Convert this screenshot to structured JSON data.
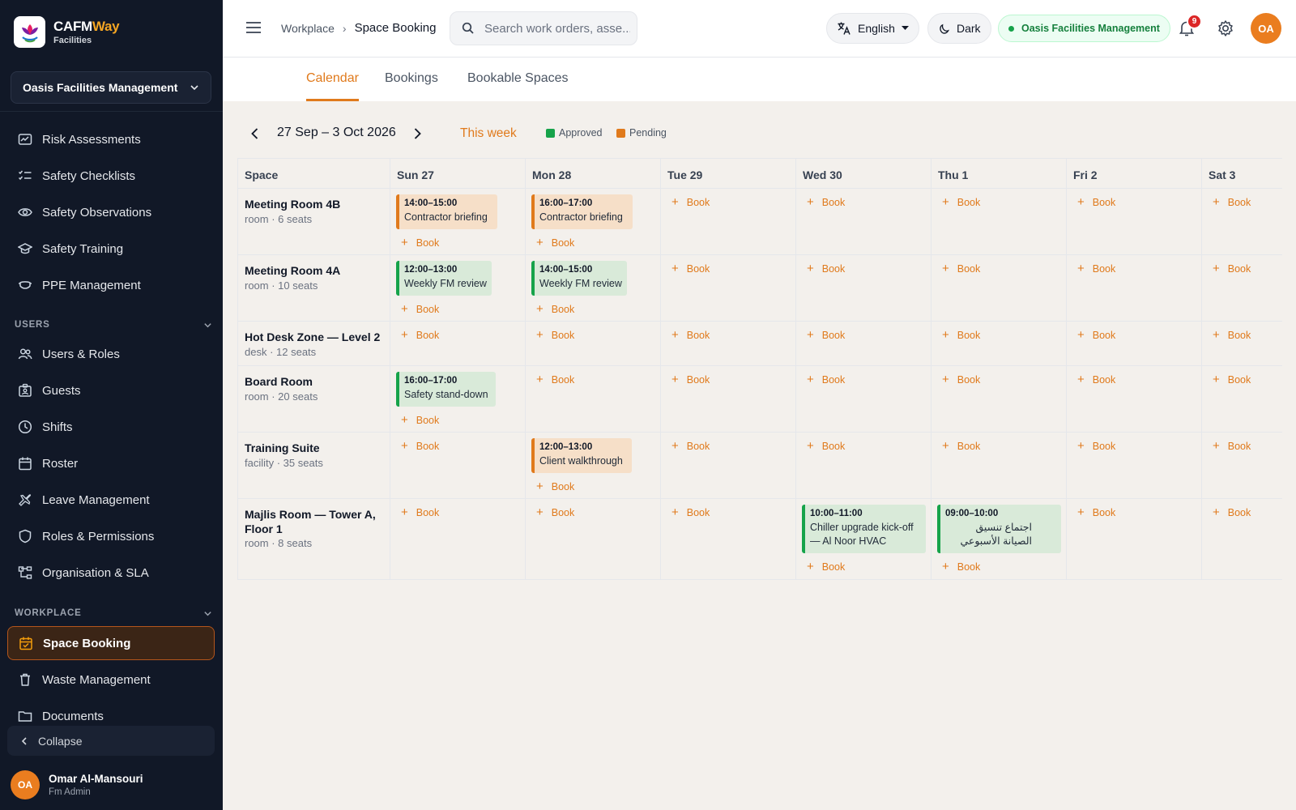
{
  "brand": {
    "name_main": "CAFM",
    "name_accent": "Way",
    "subtitle": "Facilities"
  },
  "sidebar": {
    "org": "Oasis Facilities Management",
    "items_top": [
      {
        "label": "Risk Assessments",
        "icon": "risk-assessment-icon"
      },
      {
        "label": "Safety Checklists",
        "icon": "checklist-icon"
      },
      {
        "label": "Safety Observations",
        "icon": "eye-icon"
      },
      {
        "label": "Safety Training",
        "icon": "graduation-cap-icon"
      },
      {
        "label": "PPE Management",
        "icon": "ppe-mask-icon"
      }
    ],
    "section_users": "USERS",
    "items_users": [
      {
        "label": "Users & Roles",
        "icon": "users-icon"
      },
      {
        "label": "Guests",
        "icon": "guest-badge-icon"
      },
      {
        "label": "Shifts",
        "icon": "clock-icon"
      },
      {
        "label": "Roster",
        "icon": "calendar-icon"
      },
      {
        "label": "Leave Management",
        "icon": "plane-icon"
      },
      {
        "label": "Roles & Permissions",
        "icon": "shield-icon"
      },
      {
        "label": "Organisation & SLA",
        "icon": "org-chart-icon"
      }
    ],
    "section_workplace": "WORKPLACE",
    "items_workplace": [
      {
        "label": "Space Booking",
        "icon": "calendar-check-icon",
        "active": true
      },
      {
        "label": "Waste Management",
        "icon": "trash-icon"
      },
      {
        "label": "Documents",
        "icon": "folder-icon"
      }
    ],
    "collapse": "Collapse",
    "user": {
      "initials": "OA",
      "name": "Omar Al-Mansouri",
      "role": "Fm Admin"
    }
  },
  "topbar": {
    "breadcrumb": [
      "Workplace",
      "Space Booking"
    ],
    "search_placeholder": "Search work orders, asse...",
    "language": "English",
    "theme": "Dark",
    "org": "Oasis Facilities Management",
    "notifications": "9",
    "avatar": "OA"
  },
  "tabs": [
    "Calendar",
    "Bookings",
    "Bookable Spaces"
  ],
  "active_tab": "Calendar",
  "toolbar": {
    "range": "27 Sep – 3 Oct 2026",
    "this_week": "This week",
    "legend": [
      {
        "label": "Approved",
        "color": "#16a34a"
      },
      {
        "label": "Pending",
        "color": "#e07a1c"
      }
    ]
  },
  "calendar": {
    "space_header": "Space",
    "days": [
      "Sun 27",
      "Mon 28",
      "Tue 29",
      "Wed 30",
      "Thu 1",
      "Fri 2",
      "Sat 3"
    ],
    "book_label": "Book",
    "rows": [
      {
        "name": "Meeting Room 4B",
        "meta": "room · 6 seats",
        "bookings": [
          {
            "day": 0,
            "time": "14:00–15:00",
            "title": "Contractor briefing",
            "status": "pending"
          },
          {
            "day": 1,
            "time": "16:00–17:00",
            "title": "Contractor briefing",
            "status": "pending"
          }
        ]
      },
      {
        "name": "Meeting Room 4A",
        "meta": "room · 10 seats",
        "bookings": [
          {
            "day": 0,
            "time": "12:00–13:00",
            "title": "Weekly FM review",
            "status": "approved"
          },
          {
            "day": 1,
            "time": "14:00–15:00",
            "title": "Weekly FM review",
            "status": "approved"
          }
        ]
      },
      {
        "name": "Hot Desk Zone — Level 2",
        "meta": "desk · 12 seats",
        "bookings": []
      },
      {
        "name": "Board Room",
        "meta": "room · 20 seats",
        "bookings": [
          {
            "day": 0,
            "time": "16:00–17:00",
            "title": "Safety stand-down",
            "status": "approved"
          }
        ]
      },
      {
        "name": "Training Suite",
        "meta": "facility · 35 seats",
        "bookings": [
          {
            "day": 1,
            "time": "12:00–13:00",
            "title": "Client walkthrough",
            "status": "pending"
          }
        ]
      },
      {
        "name": "Majlis Room — Tower A, Floor 1",
        "meta": "room · 8 seats",
        "bookings": [
          {
            "day": 3,
            "time": "10:00–11:00",
            "title": "Chiller upgrade kick-off — Al Noor HVAC",
            "status": "approved"
          },
          {
            "day": 4,
            "time": "09:00–10:00",
            "title": "اجتماع تنسيق الصيانة الأسبوعي",
            "status": "approved"
          }
        ]
      }
    ]
  }
}
